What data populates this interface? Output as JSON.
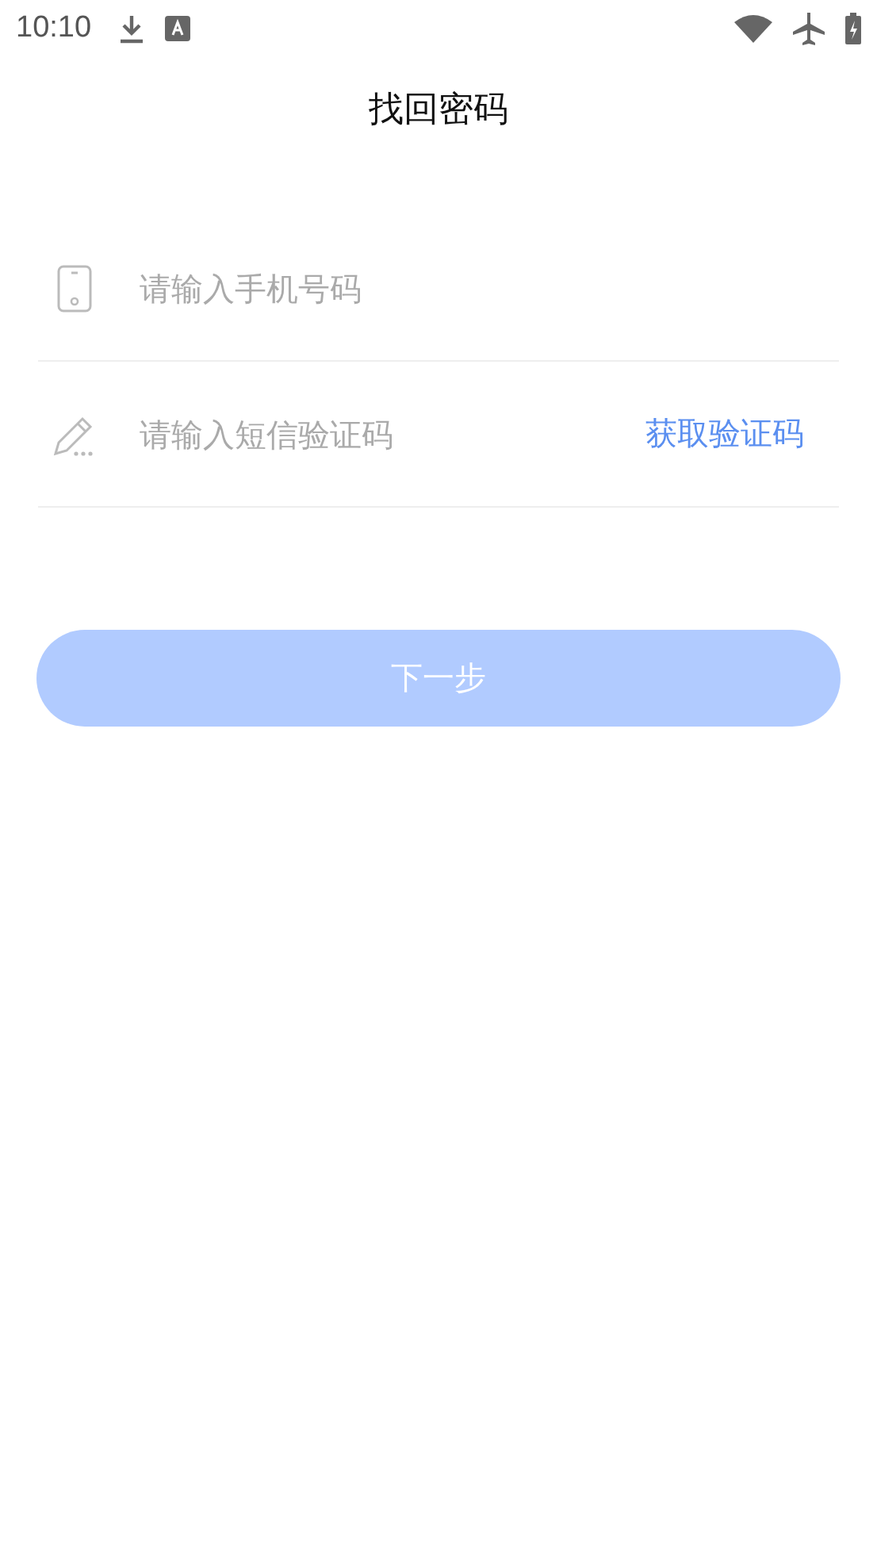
{
  "status_bar": {
    "time": "10:10"
  },
  "title": "找回密码",
  "fields": [
    {
      "kind": "phone",
      "placeholder": "请输入手机号码"
    },
    {
      "kind": "code",
      "placeholder": "请输入短信验证码",
      "action": "获取验证码"
    }
  ],
  "next_button": {
    "label": "下一步",
    "disabled": true
  }
}
